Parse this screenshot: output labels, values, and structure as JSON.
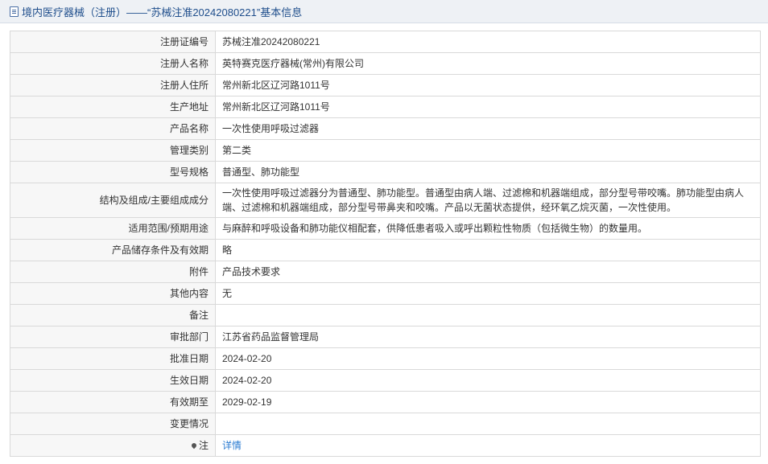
{
  "header": {
    "title": "境内医疗器械（注册）——“苏械注准20242080221”基本信息"
  },
  "rows": [
    {
      "label": "注册证编号",
      "value": "苏械注准20242080221"
    },
    {
      "label": "注册人名称",
      "value": "英特赛克医疗器械(常州)有限公司"
    },
    {
      "label": "注册人住所",
      "value": "常州新北区辽河路1011号"
    },
    {
      "label": "生产地址",
      "value": "常州新北区辽河路1011号"
    },
    {
      "label": "产品名称",
      "value": "一次性使用呼吸过滤器"
    },
    {
      "label": "管理类别",
      "value": "第二类"
    },
    {
      "label": "型号规格",
      "value": "普通型、肺功能型"
    },
    {
      "label": "结构及组成/主要组成成分",
      "value": "一次性使用呼吸过滤器分为普通型、肺功能型。普通型由病人端、过滤棉和机器端组成，部分型号带咬嘴。肺功能型由病人端、过滤棉和机器端组成，部分型号带鼻夹和咬嘴。产品以无菌状态提供，经环氧乙烷灭菌，一次性使用。"
    },
    {
      "label": "适用范围/预期用途",
      "value": "与麻醉和呼吸设备和肺功能仪相配套，供降低患者吸入或呼出颗粒性物质（包括微生物）的数量用。"
    },
    {
      "label": "产品储存条件及有效期",
      "value": "略"
    },
    {
      "label": "附件",
      "value": "产品技术要求"
    },
    {
      "label": "其他内容",
      "value": "无"
    },
    {
      "label": "备注",
      "value": ""
    },
    {
      "label": "审批部门",
      "value": "江苏省药品监督管理局"
    },
    {
      "label": "批准日期",
      "value": "2024-02-20"
    },
    {
      "label": "生效日期",
      "value": "2024-02-20"
    },
    {
      "label": "有效期至",
      "value": "2029-02-19"
    },
    {
      "label": "变更情况",
      "value": ""
    }
  ],
  "note": {
    "label": "注",
    "link": "详情"
  }
}
